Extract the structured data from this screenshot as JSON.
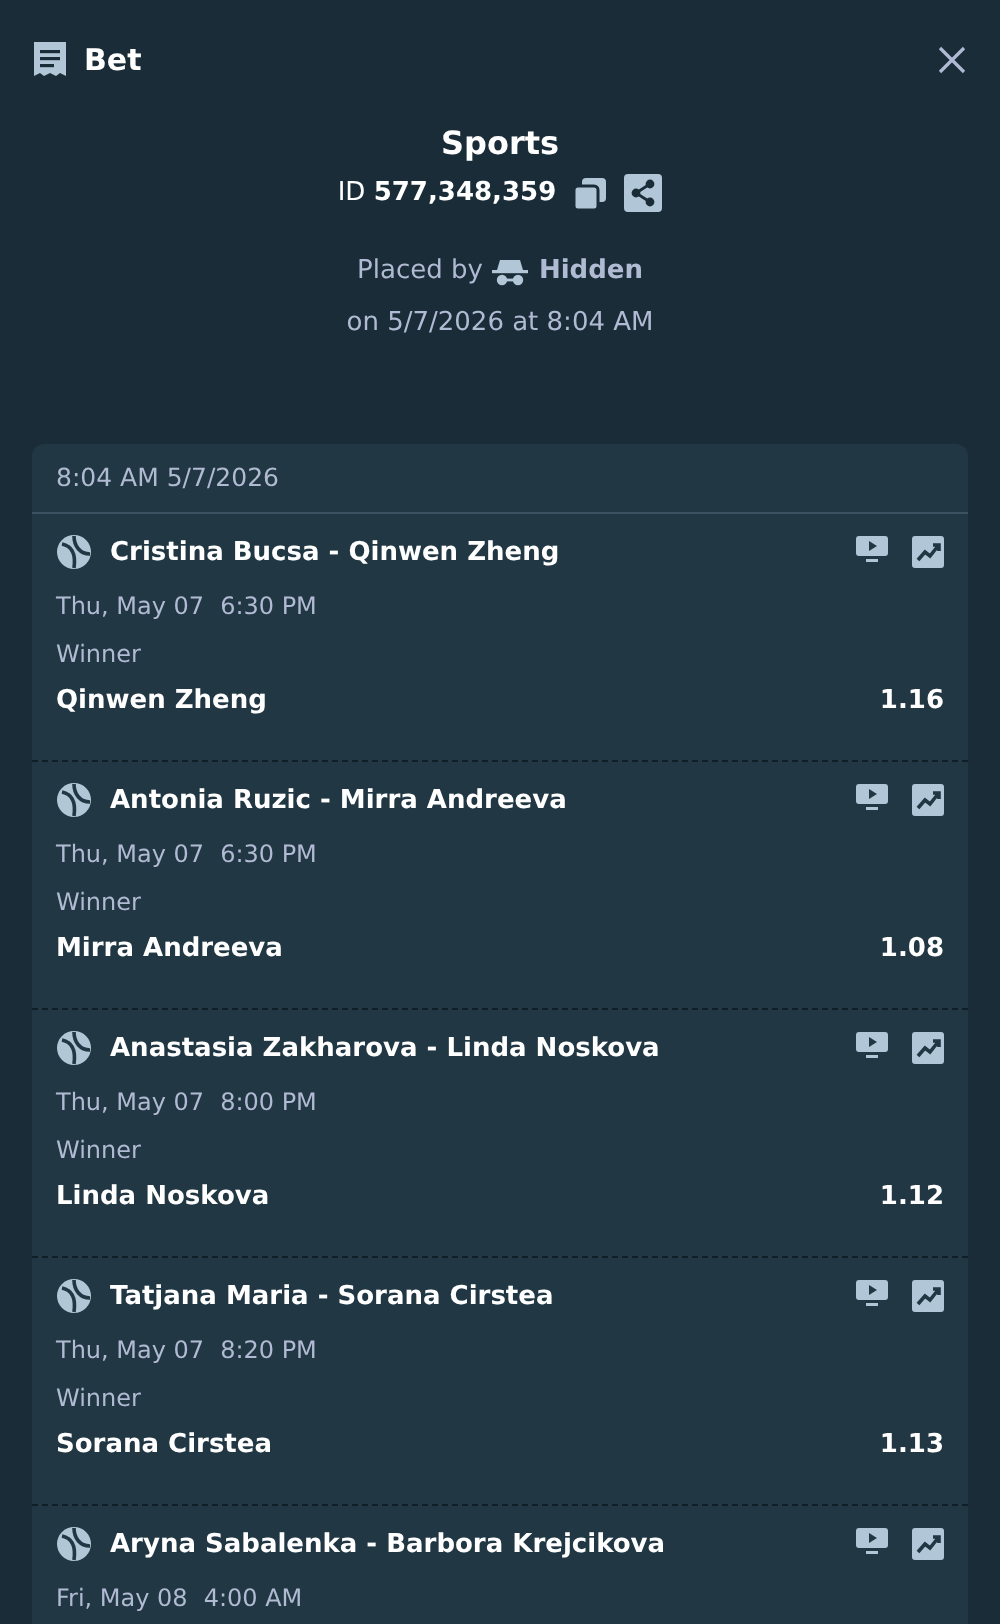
{
  "header": {
    "title": "Bet"
  },
  "bet": {
    "sport": "Sports",
    "id_label": "ID",
    "id": "577,348,359",
    "placed_by": "Placed by",
    "user": "Hidden",
    "placed_on": "on 5/7/2026 at 8:04 AM"
  },
  "slip": {
    "timestamp": "8:04 AM 5/7/2026",
    "legs": [
      {
        "event": "Cristina Bucsa - Qinwen Zheng",
        "date": "Thu, May 07",
        "time": "6:30 PM",
        "market": "Winner",
        "selection": "Qinwen Zheng",
        "odds": "1.16"
      },
      {
        "event": "Antonia Ruzic - Mirra Andreeva",
        "date": "Thu, May 07",
        "time": "6:30 PM",
        "market": "Winner",
        "selection": "Mirra Andreeva",
        "odds": "1.08"
      },
      {
        "event": "Anastasia Zakharova - Linda Noskova",
        "date": "Thu, May 07",
        "time": "8:00 PM",
        "market": "Winner",
        "selection": "Linda Noskova",
        "odds": "1.12"
      },
      {
        "event": "Tatjana Maria - Sorana Cirstea",
        "date": "Thu, May 07",
        "time": "8:20 PM",
        "market": "Winner",
        "selection": "Sorana Cirstea",
        "odds": "1.13"
      },
      {
        "event": "Aryna Sabalenka - Barbora Krejcikova",
        "date": "Fri, May 08",
        "time": "4:00 AM"
      }
    ]
  }
}
